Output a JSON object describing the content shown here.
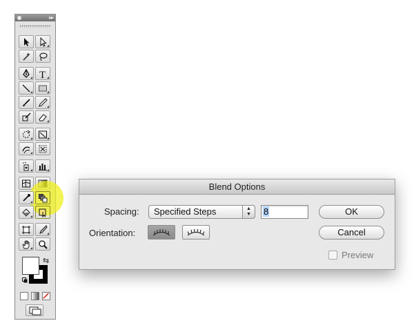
{
  "dialog": {
    "title": "Blend Options",
    "spacing_label": "Spacing:",
    "spacing_value": "Specified Steps",
    "steps_value": "8",
    "orientation_label": "Orientation:",
    "ok_label": "OK",
    "cancel_label": "Cancel",
    "preview_label": "Preview",
    "preview_checked": false,
    "selected_orientation": "align-to-page"
  },
  "toolbox": {
    "tools": [
      {
        "name": "selection-tool",
        "icon": "arrow-black-icon"
      },
      {
        "name": "direct-selection-tool",
        "icon": "arrow-white-icon"
      },
      {
        "name": "magic-wand-tool",
        "icon": "magic-wand-icon"
      },
      {
        "name": "lasso-tool",
        "icon": "lasso-icon"
      },
      {
        "name": "pen-tool",
        "icon": "pen-icon"
      },
      {
        "name": "type-tool",
        "icon": "type-icon",
        "text": "T"
      },
      {
        "name": "line-segment-tool",
        "icon": "line-icon"
      },
      {
        "name": "rectangle-tool",
        "icon": "rectangle-icon"
      },
      {
        "name": "paintbrush-tool",
        "icon": "paintbrush-icon"
      },
      {
        "name": "pencil-tool",
        "icon": "pencil-icon"
      },
      {
        "name": "blob-brush-tool",
        "icon": "blob-brush-icon"
      },
      {
        "name": "eraser-tool",
        "icon": "eraser-icon"
      },
      {
        "name": "rotate-tool",
        "icon": "rotate-icon"
      },
      {
        "name": "scale-tool",
        "icon": "scale-icon"
      },
      {
        "name": "warp-tool",
        "icon": "warp-icon"
      },
      {
        "name": "free-transform-tool",
        "icon": "free-transform-icon"
      },
      {
        "name": "symbol-sprayer-tool",
        "icon": "symbol-sprayer-icon"
      },
      {
        "name": "column-graph-tool",
        "icon": "column-graph-icon"
      },
      {
        "name": "mesh-tool",
        "icon": "mesh-icon"
      },
      {
        "name": "gradient-tool",
        "icon": "gradient-icon"
      },
      {
        "name": "eyedropper-tool",
        "icon": "eyedropper-icon"
      },
      {
        "name": "blend-tool",
        "icon": "blend-icon"
      },
      {
        "name": "live-paint-bucket-tool",
        "icon": "paint-bucket-icon"
      },
      {
        "name": "live-paint-selection-tool",
        "icon": "live-paint-selection-icon"
      },
      {
        "name": "artboard-tool",
        "icon": "artboard-icon"
      },
      {
        "name": "slice-tool",
        "icon": "slice-icon"
      },
      {
        "name": "hand-tool",
        "icon": "hand-icon"
      },
      {
        "name": "zoom-tool",
        "icon": "magnifier-icon"
      }
    ],
    "active_tool": "blend-tool",
    "fill_color": "#ffffff",
    "stroke_color": "#000000",
    "highlight_color": "#f0f01e"
  }
}
